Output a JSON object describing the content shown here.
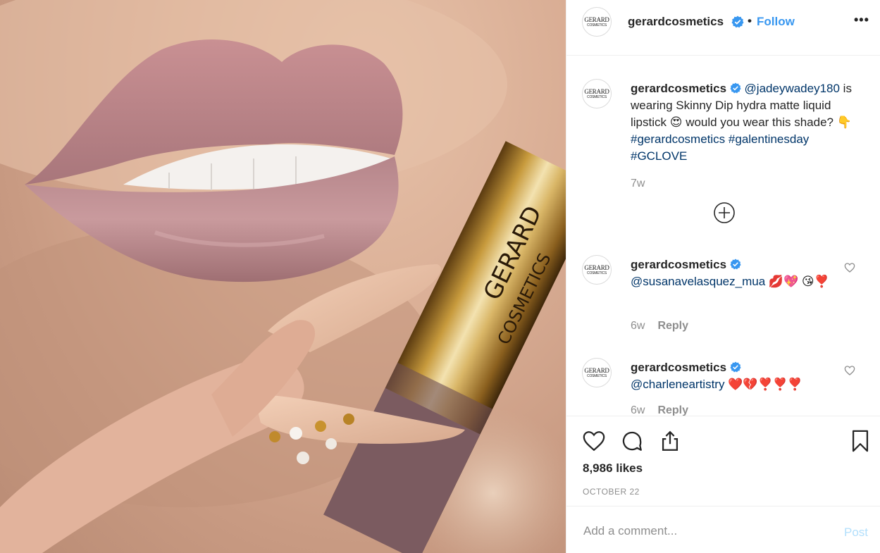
{
  "photo": {
    "brand_text_1": "GERARD",
    "brand_text_2": "COSMETICS"
  },
  "header": {
    "username": "gerardcosmetics",
    "dot": "•",
    "follow_label": "Follow",
    "more_label": "•••",
    "avatar_line1": "GERARD",
    "avatar_line2": "COSMETICS"
  },
  "caption": {
    "username": "gerardcosmetics",
    "mention": "@jadeywadey180",
    "text1": " is wearing Skinny Dip hydra matte liquid lipstick ",
    "emoji1": "😍",
    "text2": " would you wear this shade? ",
    "emoji2": "👇",
    "hashtag1": "#gerardcosmetics",
    "hashtag2": "#galentinesday",
    "hashtag3": "#GCLOVE",
    "time": "7w"
  },
  "comments": [
    {
      "username": "gerardcosmetics",
      "mention": "@susanavelasquez_mua",
      "emojis": " 💋💖 😘❣️",
      "time": "6w",
      "reply": "Reply"
    },
    {
      "username": "gerardcosmetics",
      "mention": "@charleneartistry",
      "emojis": " ❤️💔❣️❣️❣️",
      "time": "6w",
      "reply": "Reply"
    }
  ],
  "likes": "8,986 likes",
  "date": "OCTOBER 22",
  "add_comment": {
    "placeholder": "Add a comment...",
    "post_label": "Post"
  },
  "colors": {
    "link": "#003569",
    "follow": "#3897f0",
    "verified": "#3897f0",
    "post_disabled": "#b2dffc",
    "muted": "#8e8e8e"
  }
}
